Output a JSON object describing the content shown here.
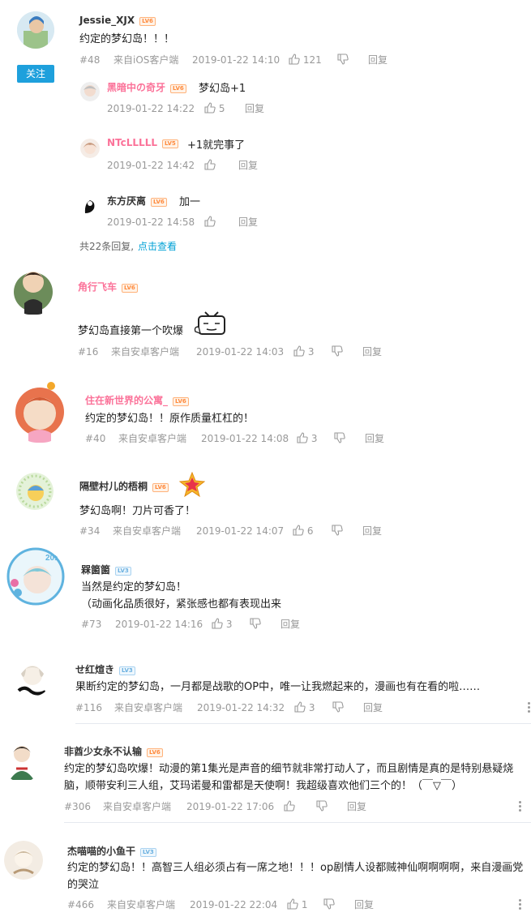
{
  "icons": {
    "like": "thumb-up-icon",
    "dislike": "thumb-down-icon",
    "more": "more-vertical-icon"
  },
  "colors": {
    "link": "#00a1d6",
    "vip_name": "#fb7299",
    "follow_bg": "#1ea0dc"
  },
  "follow_label": "关注",
  "reply_label": "回复",
  "comments": [
    {
      "user": "Jessie_XJX",
      "level": "LV6",
      "text": "约定的梦幻岛！！！",
      "floor": "#48",
      "client": "来自iOS客户端",
      "time": "2019-01-22 14:10",
      "likes": "121",
      "replies": [
        {
          "user": "黑暗中の奇牙",
          "level": "LV6",
          "text": "梦幻岛+1",
          "time": "2019-01-22 14:22",
          "likes": "5"
        },
        {
          "user": "NTcLLLLL",
          "level": "LV5",
          "text": "+1就完事了",
          "time": "2019-01-22 14:42",
          "likes": ""
        },
        {
          "user": "东方厌离",
          "level": "LV6",
          "text": "加一",
          "time": "2019-01-22 14:58",
          "likes": ""
        }
      ],
      "replies_summary_prefix": "共22条回复,",
      "replies_summary_link": "点击查看"
    },
    {
      "user": "角行飞车",
      "level": "LV6",
      "text": "梦幻岛直接第一个吹爆",
      "floor": "#16",
      "client": "来自安卓客户端",
      "time": "2019-01-22 14:03",
      "likes": "3"
    },
    {
      "user": "住在新世界的公寓_",
      "level": "LV6",
      "text": "约定的梦幻岛！！原作质量杠杠的！",
      "floor": "#40",
      "client": "来自安卓客户端",
      "time": "2019-01-22 14:08",
      "likes": "3"
    },
    {
      "user": "隔壁村儿的梧桐",
      "level": "LV6",
      "text": "梦幻岛啊！刀片可香了！",
      "floor": "#34",
      "client": "来自安卓客户端",
      "time": "2019-01-22 14:07",
      "likes": "6"
    },
    {
      "user": "槑箘箘",
      "level": "LV3",
      "text_line1": "当然是约定的梦幻岛！",
      "text_line2": "（动画化品质很好，紧张感也都有表现出来",
      "floor": "#73",
      "client": "",
      "time": "2019-01-22 14:16",
      "likes": "3"
    },
    {
      "user": "せ红煊き",
      "level": "LV3",
      "text": "果断约定的梦幻岛，一月都是战歌的OP中，唯一让我燃起来的，漫画也有在看的啦……",
      "floor": "#116",
      "client": "来自安卓客户端",
      "time": "2019-01-22 14:32",
      "likes": "3"
    },
    {
      "user": "非酋少女永不认输",
      "level": "LV6",
      "text": "约定的梦幻岛吹爆！动漫的第1集光是声音的细节就非常打动人了，而且剧情是真的是特别悬疑烧脑，顺带安利三人组，艾玛诺曼和雷都是天使啊！我超级喜欢他们三个的！（￣▽￣）",
      "floor": "#306",
      "client": "来自安卓客户端",
      "time": "2019-01-22 17:06",
      "likes": ""
    },
    {
      "user": "杰喵喵的小鱼干",
      "level": "LV3",
      "text": "约定的梦幻岛！！高智三人组必须占有一席之地！！！op剧情人设都贼神仙啊啊啊啊，来自漫画党的哭泣",
      "floor": "#466",
      "client": "来自安卓客户端",
      "time": "2019-01-22 22:04",
      "likes": "1"
    }
  ]
}
